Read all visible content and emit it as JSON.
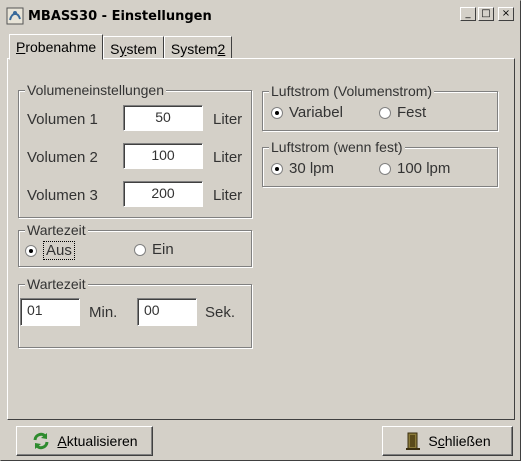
{
  "window": {
    "title": "MBASS30 - Einstellungen",
    "buttons": {
      "minimize": "_",
      "maximize": "□",
      "close": "×"
    }
  },
  "tabs": [
    {
      "label": "Probenahme",
      "accel": "P",
      "rest": "robenahme",
      "active": true
    },
    {
      "label": "System",
      "pre": "S",
      "accel": "y",
      "rest": "stem",
      "active": false
    },
    {
      "label": "System2",
      "pre": "System",
      "accel": "2",
      "rest": "",
      "active": false
    }
  ],
  "volumen": {
    "legend": "Volumeneinstellungen",
    "rows": [
      {
        "label": "Volumen 1",
        "value": "50",
        "unit": "Liter"
      },
      {
        "label": "Volumen 2",
        "value": "100",
        "unit": "Liter"
      },
      {
        "label": "Volumen 3",
        "value": "200",
        "unit": "Liter"
      }
    ]
  },
  "luftstrom": {
    "legend": "Luftstrom (Volumenstrom)",
    "options": [
      {
        "label": "Variabel",
        "checked": true
      },
      {
        "label": "Fest",
        "checked": false
      }
    ]
  },
  "luftstrom_fest": {
    "legend": "Luftstrom (wenn fest)",
    "options": [
      {
        "label": "30 lpm",
        "checked": true
      },
      {
        "label": "100 lpm",
        "checked": false
      }
    ]
  },
  "wartezeit_toggle": {
    "legend": "Wartezeit",
    "options": [
      {
        "label": "Aus",
        "checked": true
      },
      {
        "label": "Ein",
        "checked": false
      }
    ]
  },
  "wartezeit_time": {
    "legend": "Wartezeit",
    "minutes": "01",
    "minutes_unit": "Min.",
    "seconds": "00",
    "seconds_unit": "Sek."
  },
  "footer": {
    "refresh_accel": "A",
    "refresh_rest": "ktualisieren",
    "close_pre": "S",
    "close_accel": "c",
    "close_rest": "hließen"
  },
  "colors": {
    "face": "#d4d0c8",
    "refresh_icon": "#2e8b2e",
    "close_icon": "#6a5a2a"
  }
}
